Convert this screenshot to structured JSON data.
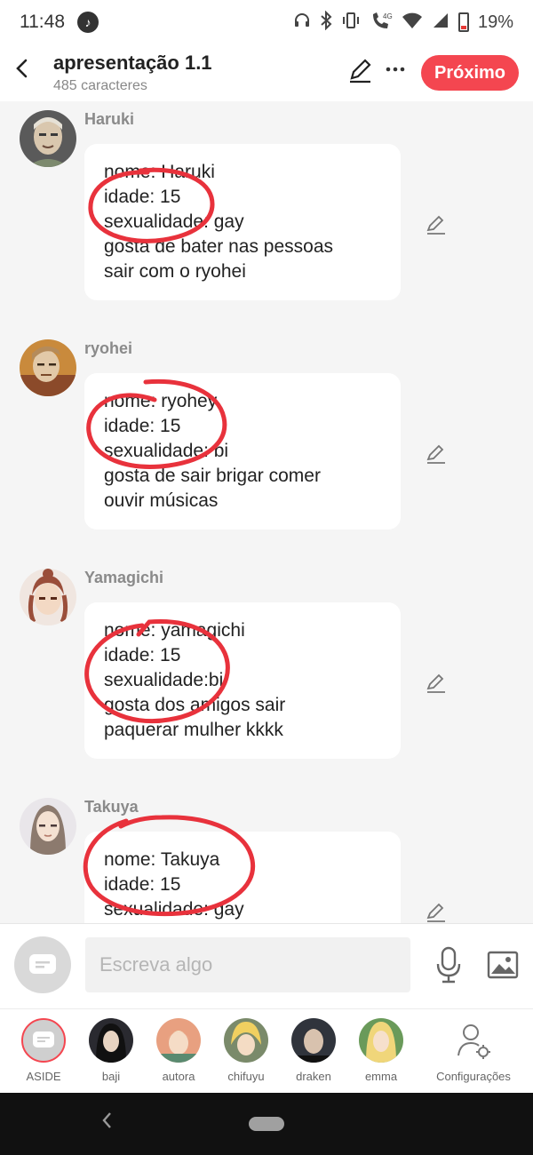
{
  "status": {
    "time": "11:48",
    "signal": "4G",
    "battery": "19%"
  },
  "header": {
    "title": "apresentação 1.1",
    "subtitle": "485 caracteres",
    "next_label": "Próximo"
  },
  "messages": [
    {
      "name": "Haruki",
      "lines": [
        "nome: Haruki",
        "idade: 15",
        "sexualidade: gay",
        "gosta de bater nas pessoas",
        "sair com o ryohei"
      ]
    },
    {
      "name": "ryohei",
      "lines": [
        "nome: ryohey",
        "idade: 15",
        "sexualidade: bi",
        "gosta de sair brigar comer",
        "ouvir músicas"
      ]
    },
    {
      "name": "Yamagichi",
      "lines": [
        "nome: yamagichi",
        "idade: 15",
        "sexualidade:bi",
        "gosta dos amigos sair",
        "paquerar mulher kkkk"
      ]
    },
    {
      "name": "Takuya",
      "lines": [
        "nome: Takuya",
        "idade: 15",
        "sexualidade: gay"
      ]
    }
  ],
  "input": {
    "placeholder": "Escreva algo"
  },
  "tabs": [
    {
      "label": "ASIDE"
    },
    {
      "label": "baji"
    },
    {
      "label": "autora"
    },
    {
      "label": "chifuyu"
    },
    {
      "label": "draken"
    },
    {
      "label": "emma"
    },
    {
      "label": "Configurações"
    }
  ],
  "colors": {
    "accent": "#f44650",
    "annotation": "#e8323c"
  }
}
